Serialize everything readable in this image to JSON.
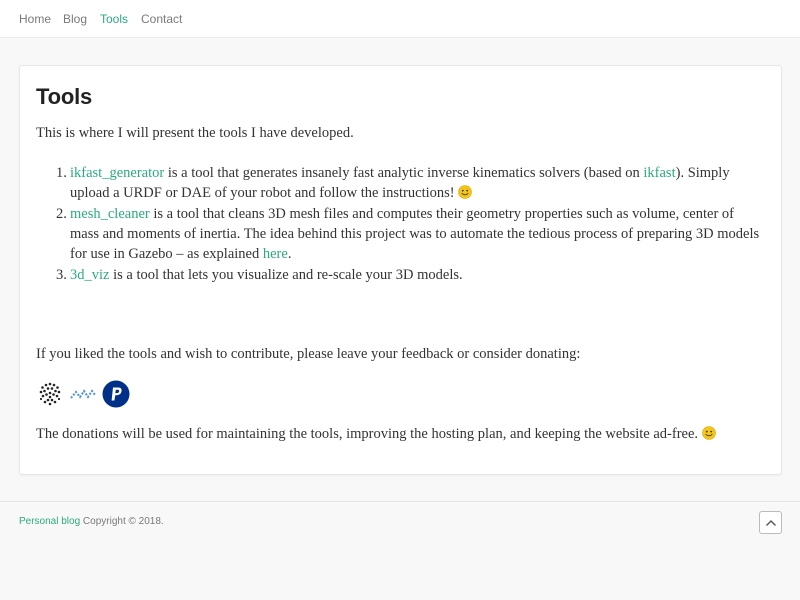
{
  "nav": {
    "items": [
      {
        "label": "Home",
        "active": false
      },
      {
        "label": "Blog",
        "active": false
      },
      {
        "label": "Tools",
        "active": true
      },
      {
        "label": "Contact",
        "active": false
      }
    ]
  },
  "page": {
    "title": "Tools",
    "intro": "This is where I will present the tools I have developed."
  },
  "tools": [
    {
      "number": "1.",
      "link": "ikfast_generator",
      "text_a": " is a tool that generates insanely fast analytic inverse kinematics solvers (based on ",
      "link2": "ikfast",
      "text_b": "). Simply upload a URDF or DAE of your robot and follow the instructions! "
    },
    {
      "number": "2.",
      "link": "mesh_cleaner",
      "text_a": " is a tool that cleans 3D mesh files and computes their geometry properties such as volume, center of mass and moments of inertia. The idea behind this project was to automate the tedious process of preparing 3D models for use in Gazebo – as explained ",
      "link2": "here",
      "text_b": "."
    },
    {
      "number": "3.",
      "link": "3d_viz",
      "text_a": " is a tool that lets you visualize and re-scale your 3D models."
    }
  ],
  "contribute_text": "If you liked the tools and wish to contribute, please leave your feedback or consider donating:",
  "donate_icons": [
    "iota-icon",
    "nano-icon",
    "paypal-icon"
  ],
  "donations_text": "The donations will be used for maintaining the tools, improving the hosting plan, and keeping the website ad-free. ",
  "footer": {
    "blog_link": "Personal blog",
    "copyright": " Copyright © 2018."
  },
  "colors": {
    "accent": "#2bab7e",
    "nav_text": "#7a7a7a",
    "paypal": "#003087",
    "nano": "#4a90e2",
    "smiley": "#f5c518"
  }
}
